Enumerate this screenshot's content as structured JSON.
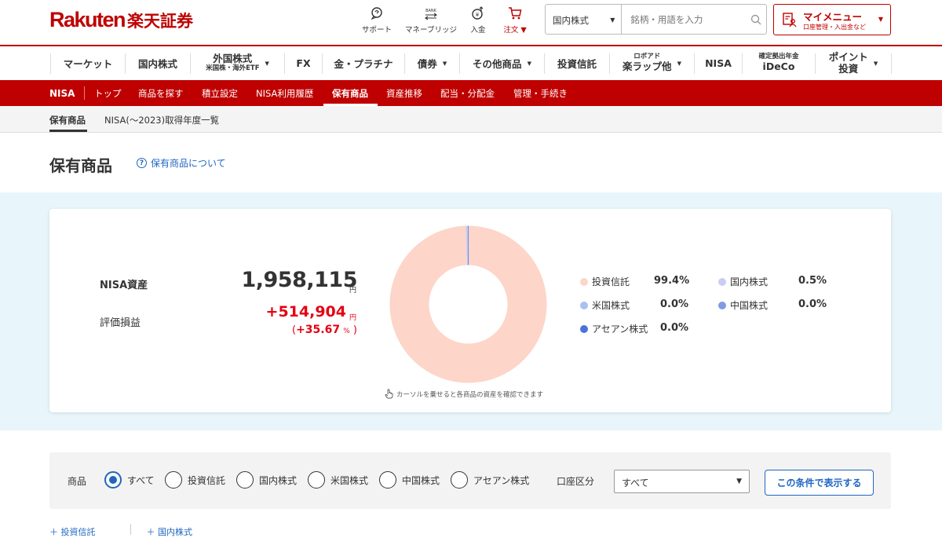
{
  "header": {
    "logo_rakuten": "Rakuten",
    "logo_jp": "楽天証券",
    "icons": [
      {
        "name": "support-icon",
        "label": "サポート"
      },
      {
        "name": "money-bridge-icon",
        "label": "マネーブリッジ"
      },
      {
        "name": "deposit-icon",
        "label": "入金"
      },
      {
        "name": "cart-icon",
        "label": "注文 ▼"
      }
    ],
    "search_category": "国内株式",
    "search_placeholder": "銘柄・用語を入力",
    "mymenu_title": "マイメニュー",
    "mymenu_sub": "口座管理・入出金など"
  },
  "mainnav": [
    {
      "label": "マーケット"
    },
    {
      "label": "国内株式"
    },
    {
      "label": "外国株式",
      "sub": "米国株・海外ETF"
    },
    {
      "label": "FX"
    },
    {
      "label": "金・プラチナ"
    },
    {
      "label": "債券"
    },
    {
      "label": "その他商品"
    },
    {
      "label": "投資信託"
    },
    {
      "label": "楽ラップ他",
      "pre": "ロボアド"
    },
    {
      "label": "NISA"
    },
    {
      "label": "iDeCo",
      "pre": "確定拠出年金"
    },
    {
      "label": "投資",
      "pre": "ポイント"
    }
  ],
  "subnav": {
    "tag": "NISA",
    "links": [
      "トップ",
      "商品を探す",
      "積立設定",
      "NISA利用履歴",
      "保有商品",
      "資産推移",
      "配当・分配金",
      "管理・手続き"
    ]
  },
  "graynav": {
    "active": "保有商品",
    "other": "NISA(〜2023)取得年度一覧"
  },
  "page": {
    "title": "保有商品",
    "help_link": "保有商品について"
  },
  "summary": {
    "asset_label": "NISA資産",
    "asset_value": "1,958,115",
    "yen": "円",
    "pl_label": "評価損益",
    "pl_value": "+514,904",
    "pl_pct_open": "(",
    "pl_pct": "+35.67",
    "pl_pct_unit": "%",
    "pl_pct_close": ")",
    "hint": "カーソルを乗せると各商品の資産を確認できます"
  },
  "chart_data": {
    "type": "pie",
    "categories": [
      "投資信託",
      "国内株式",
      "米国株式",
      "中国株式",
      "アセアン株式"
    ],
    "values": [
      99.4,
      0.5,
      0.0,
      0.0,
      0.0
    ],
    "labels": [
      "99.4%",
      "0.5%",
      "0.0%",
      "0.0%",
      "0.0%"
    ],
    "colors": [
      "#fdd5c9",
      "#c9cdf3",
      "#a9c0f1",
      "#7f9be6",
      "#4c72d8"
    ]
  },
  "filter": {
    "product_label": "商品",
    "options": [
      "すべて",
      "投資信託",
      "国内株式",
      "米国株式",
      "中国株式",
      "アセアン株式"
    ],
    "selected_index": 0,
    "account_label": "口座区分",
    "account_value": "すべて",
    "submit": "この条件で表示する"
  },
  "bottom_tabs": [
    "投資信託",
    "国内株式"
  ],
  "colors": {
    "brand": "#bf0000",
    "link": "#1f66c1",
    "profit": "#e50012",
    "band": "#e8f6fb"
  }
}
